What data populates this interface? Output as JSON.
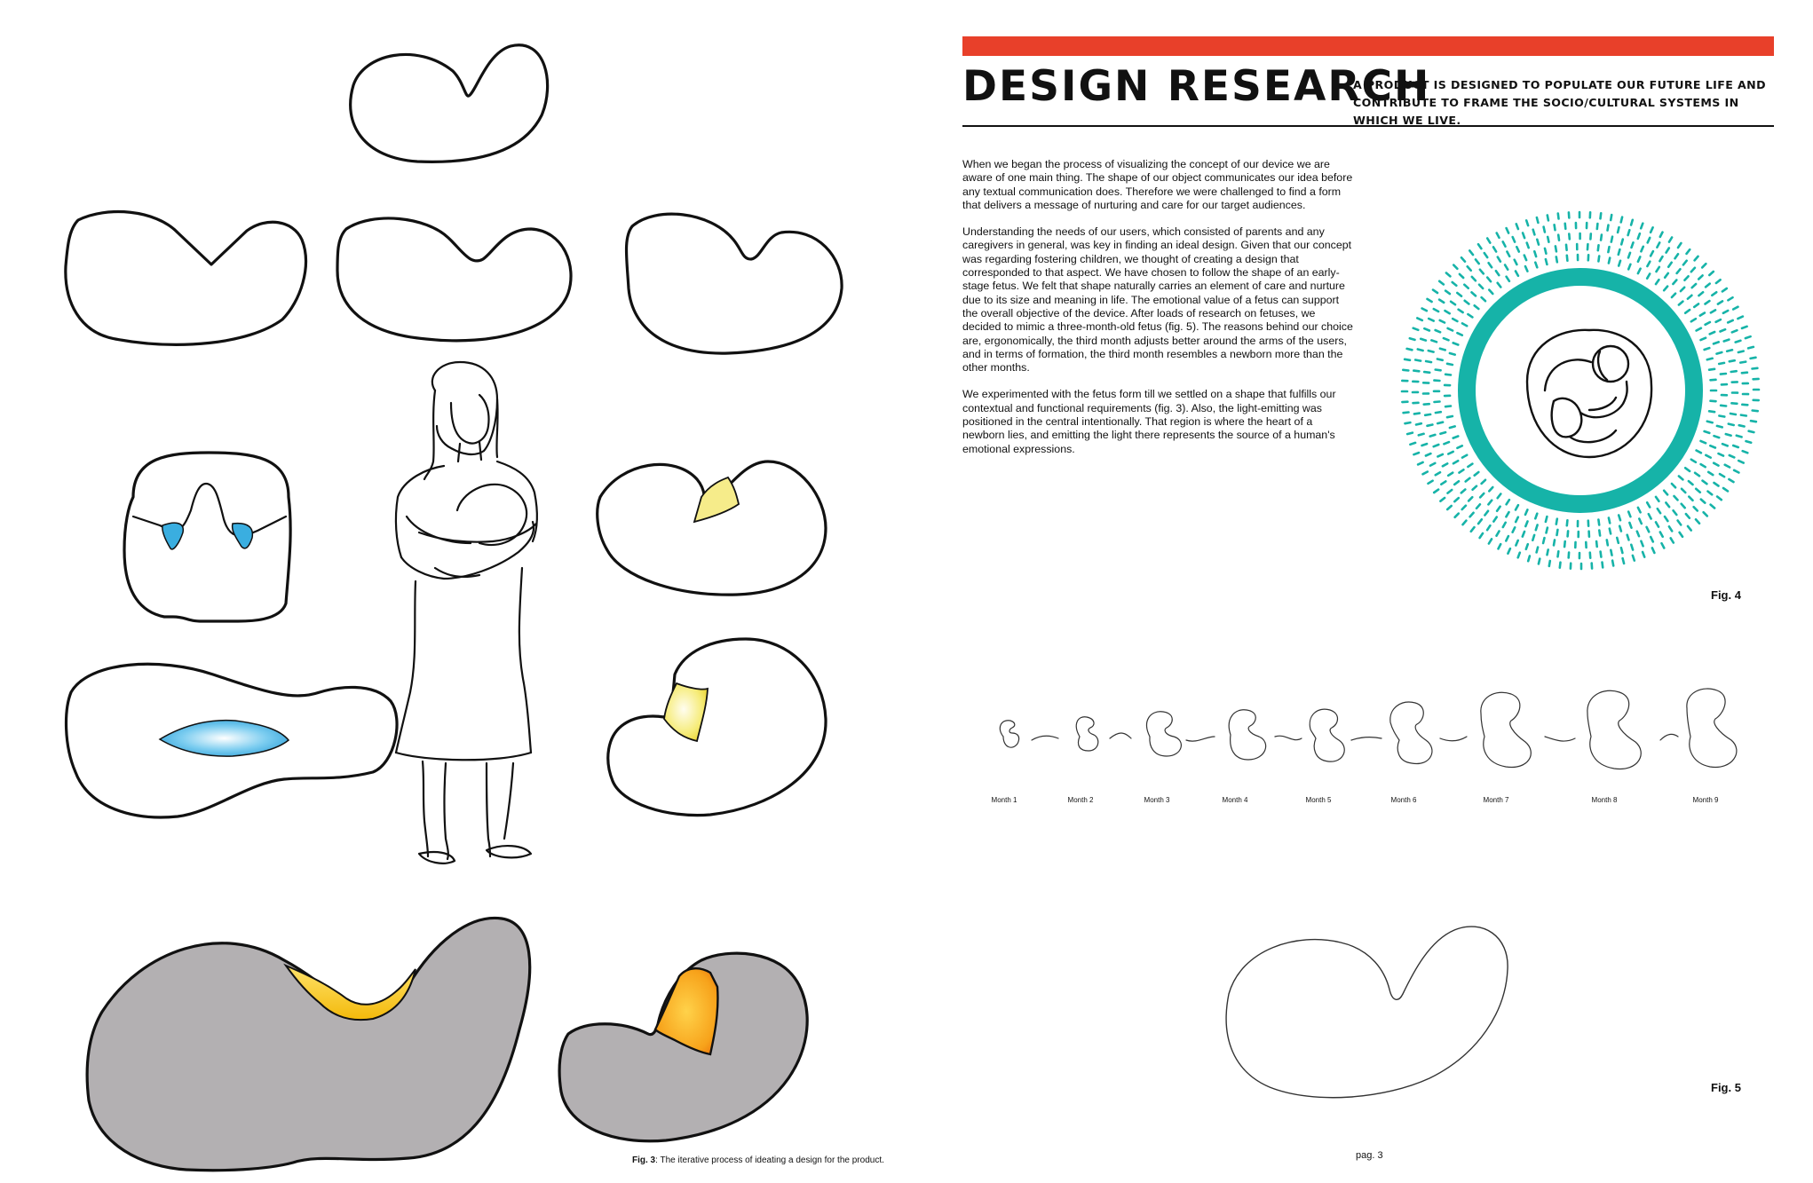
{
  "header": {
    "title": "DESIGN RESEARCH",
    "subtitle": "A PRODUCT IS DESIGNED TO POPULATE OUR FUTURE LIFE AND CONTRIBUTE TO FRAME THE SOCIO/CULTURAL SYSTEMS IN WHICH WE LIVE."
  },
  "body": {
    "paragraphs": [
      "When we began the process of visualizing the concept of our device we are aware of one main thing. The shape of our object communicates our idea before any textual communication does. Therefore we were challenged to find a form that delivers a message of nurturing and care for our target audiences.",
      "Understanding the needs of our users, which consisted of parents and any caregivers in general, was key in finding an ideal design. Given that our concept was regarding fostering children, we thought of creating a design that corresponded to that aspect. We have chosen to follow the shape of an early-stage fetus. We felt that shape naturally carries an element of care and nurture due to its size and meaning in life. The emotional value of a fetus can support the overall objective of the device. After loads of research on fetuses, we decided to mimic a three-month-old fetus (fig. 5). The reasons behind our choice are, ergonomically, the third month adjusts better around the arms of the users, and in terms of formation, the third month resembles a newborn more than the other months.",
      "We experimented with the fetus form till we settled on a shape that fulfills our contextual and functional requirements (fig. 3). Also, the light-emitting was positioned in the central intentionally. That region is where the heart of a newborn lies, and emitting the light there represents the source of a human's emotional expressions."
    ]
  },
  "figures": {
    "fig3": {
      "label": "Fig. 3",
      "caption": ": The iterative process of ideating a design for the product."
    },
    "fig4": {
      "label": "Fig. 4"
    },
    "fig5": {
      "label": "Fig. 5"
    }
  },
  "months": [
    "Month 1",
    "Month 2",
    "Month 3",
    "Month 4",
    "Month 5",
    "Month 6",
    "Month 7",
    "Month 8",
    "Month 9"
  ],
  "page": {
    "number": "pag. 3"
  },
  "colors": {
    "accent_bar": "#e8402a",
    "teal": "#16b3a8",
    "light_blue": "#3aaee0",
    "light_yellow": "#f4e03a",
    "orange_glow": "#f08a10",
    "gray_fill": "#b3b0b2"
  },
  "icons": {
    "fetus_icon": "fetus-in-circle-icon",
    "arrow": "curved-arrow-icon"
  }
}
